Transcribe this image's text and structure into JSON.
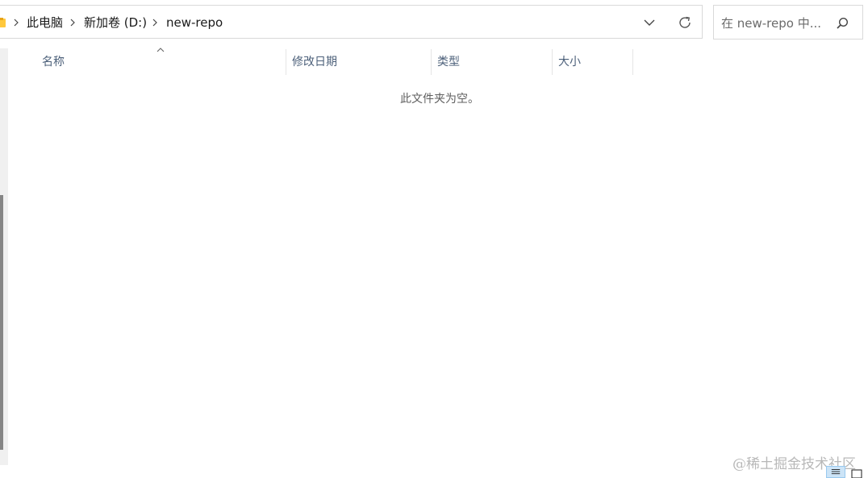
{
  "address_bar": {
    "breadcrumbs": [
      "此电脑",
      "新加卷 (D:)",
      "new-repo"
    ],
    "separator_icon": "chevron-right-icon",
    "dropdown_icon": "chevron-down-icon",
    "refresh_icon": "refresh-icon"
  },
  "search": {
    "placeholder": "在 new-repo 中...",
    "icon": "search-icon"
  },
  "columns": {
    "name": "名称",
    "date_modified": "修改日期",
    "type": "类型",
    "size": "大小",
    "sort_icon": "sort-ascending-icon"
  },
  "content": {
    "empty_message": "此文件夹为空。"
  },
  "watermark": "@稀土掘金技术社区",
  "status_bar": {
    "details_view_icon": "details-view-icon",
    "tiles_view_icon": "tiles-view-icon"
  },
  "colors": {
    "accent": "#0078d4",
    "header_text": "#4c607a",
    "folder": "#ffc83d"
  }
}
